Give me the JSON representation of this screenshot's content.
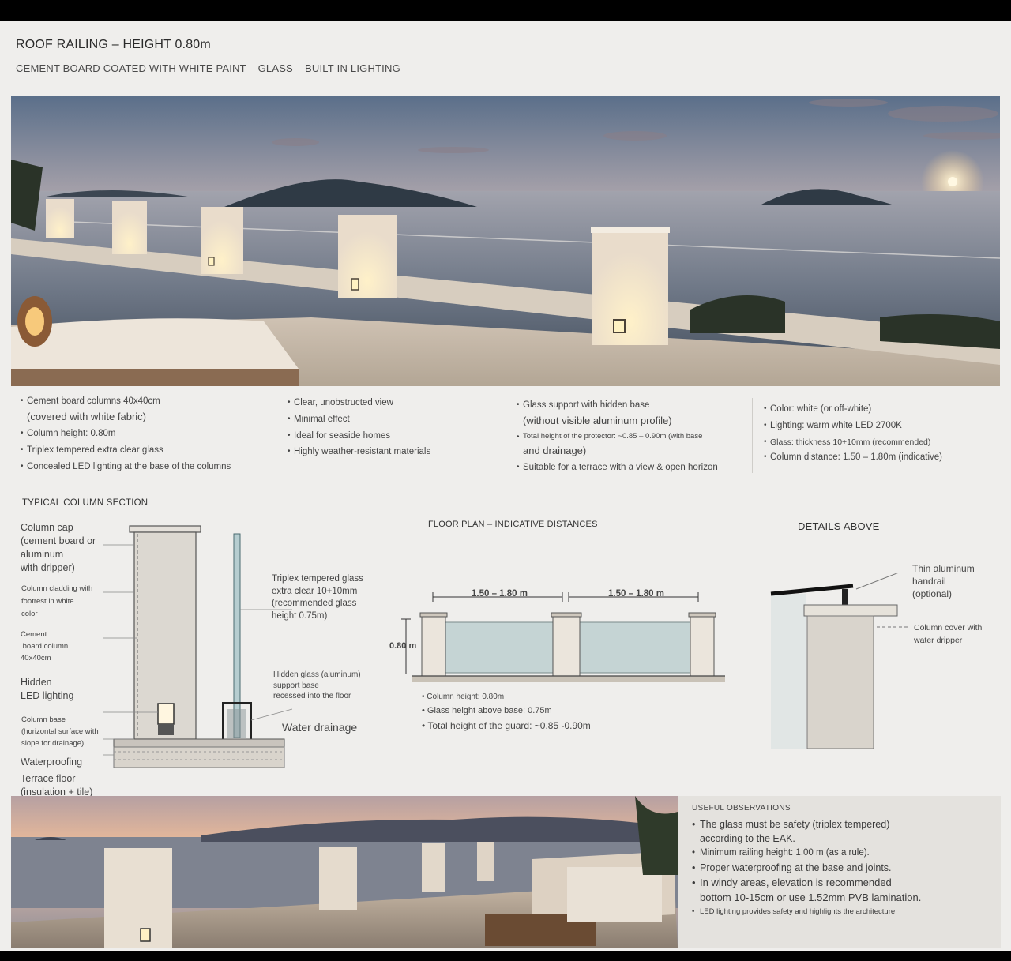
{
  "header": {
    "title": "ROOF RAILING – HEIGHT 0.80m",
    "subtitle": "CEMENT BOARD COATED WITH WHITE PAINT – GLASS – BUILT-IN LIGHTING"
  },
  "features": {
    "col1": [
      {
        "text": "Cement board columns 40x40cm",
        "sub": "(covered with white fabric)"
      },
      {
        "text": "Column height: 0.80m",
        "sub": ""
      },
      {
        "text": "Triplex tempered extra clear glass",
        "sub": ""
      },
      {
        "text": "Concealed LED lighting at the base of the columns",
        "sub": ""
      }
    ],
    "col2": [
      {
        "text": "Clear, unobstructed view",
        "sub": ""
      },
      {
        "text": "Minimal effect",
        "sub": ""
      },
      {
        "text": "Ideal for seaside homes",
        "sub": ""
      },
      {
        "text": "Highly weather-resistant materials",
        "sub": ""
      }
    ],
    "col3": [
      {
        "text": "Glass support with hidden base",
        "sub": "(without visible aluminum profile)"
      },
      {
        "text": "Total height of the protector: ~0.85 – 0.90m (with base",
        "sub": "and drainage)"
      },
      {
        "text": "Suitable for a terrace with a view & open horizon",
        "sub": ""
      }
    ],
    "col4": [
      {
        "text": "Color: white (or off-white)",
        "sub": ""
      },
      {
        "text": "Lighting: warm white LED 2700K",
        "sub": ""
      },
      {
        "text": "Glass: thickness 10+10mm (recommended)",
        "sub": ""
      },
      {
        "text": "Column distance: 1.50 – 1.80m (indicative)",
        "sub": ""
      }
    ]
  },
  "section": {
    "title": "TYPICAL COLUMN SECTION",
    "labels": {
      "cap": "Column cap\n(cement board or\naluminum\nwith dripper)",
      "cladding": "Column cladding with\nfootrest in white\ncolor",
      "board": "Cement\n board column\n40x40cm",
      "led": "Hidden\nLED lighting",
      "base": "Column base\n(horizontal surface with\nslope for drainage)",
      "waterproofing": "Waterproofing",
      "floor": "Terrace floor\n(insulation + tile)",
      "glass": "Triplex tempered glass\nextra clear 10+10mm\n(recommended glass\nheight 0.75m)",
      "glass_base": "Hidden glass (aluminum)\nsupport base\nrecessed into the floor",
      "drainage": "Water drainage"
    }
  },
  "plan": {
    "title": "FLOOR PLAN – INDICATIVE DISTANCES",
    "dim1": "1.50 – 1.80 m",
    "dim2": "1.50 – 1.80 m",
    "height": "0.80 m",
    "notes": [
      "Column height: 0.80m",
      "Glass height above base: 0.75m",
      "Total height of the guard: ~0.85 -0.90m"
    ]
  },
  "details": {
    "title": "DETAILS ABOVE",
    "handrail": "Thin aluminum\nhandrail\n(optional)",
    "cover": "Column cover with\nwater dripper"
  },
  "observations": {
    "title": "USEFUL OBSERVATIONS",
    "items": [
      "The glass must be safety (triplex tempered)\naccording to the EAK.",
      "Minimum railing height: 1.00 m (as a rule).",
      "Proper waterproofing at the base and joints.",
      "In windy areas, elevation is recommended\nbottom 10-15cm or use 1.52mm PVB lamination."
    ],
    "small_item": "LED lighting provides safety and highlights the architecture."
  }
}
